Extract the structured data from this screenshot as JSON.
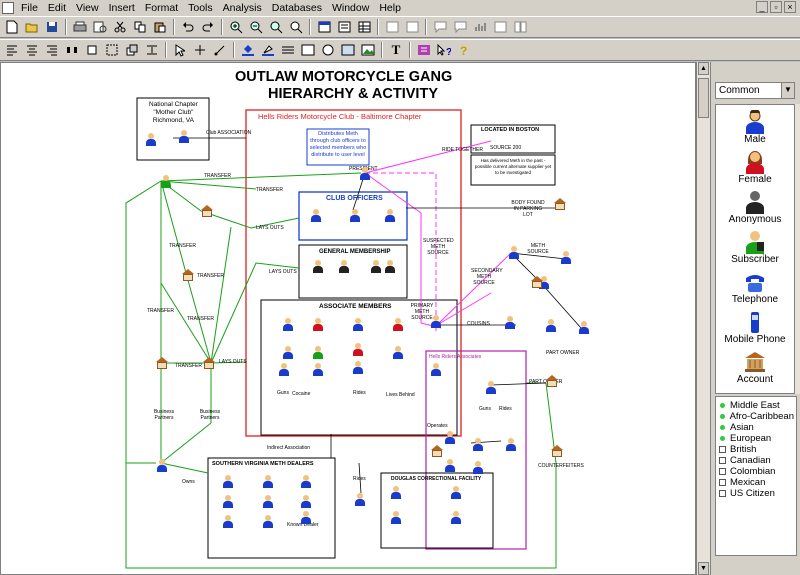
{
  "menu": [
    "File",
    "Edit",
    "View",
    "Insert",
    "Format",
    "Tools",
    "Analysis",
    "Databases",
    "Window",
    "Help"
  ],
  "window_controls": [
    "_",
    "▫",
    "×"
  ],
  "toolbar1": [
    "new-icon",
    "open-icon",
    "save-icon",
    "print-icon",
    "print-preview-icon",
    "cut-icon",
    "copy-icon",
    "paste-icon",
    "undo-icon",
    "redo-icon",
    "zoom-in-icon",
    "zoom-out-icon",
    "zoom-fit-icon",
    "zoom-select-icon",
    "grid-icon",
    "layout-icon",
    "table-icon",
    "list-icon"
  ],
  "toolbar2": [
    "select-icon",
    "cross-icon",
    "link-icon",
    "fill-icon",
    "line-color-icon",
    "line-style-icon",
    "rect-icon",
    "circle-icon",
    "frame-icon",
    "image-icon",
    "text-icon",
    "attributes-icon",
    "help-icon"
  ],
  "toolbar2_text_btn": "T",
  "diagram": {
    "title_line1": "OUTLAW MOTORCYCLE GANG",
    "title_line2": "HIERARCHY & ACTIVITY",
    "national_chapter": "National Chapter\n\"Mother Club\"\nRichmond, VA",
    "hells_riders": "Hells Riders Motorcycle Club - Baltimore Chapter",
    "distributes": "Distributes Meth through club officers to selected members who distribute to user level",
    "club_officers": "CLUB OFFICERS",
    "general_membership": "GENERAL MEMBERSHIP",
    "associate_members": "ASSOCIATE MEMBERS",
    "southern_dealers": "SOUTHERN VIRGINIA METH DEALERS",
    "douglas": "DOUGLAS CORRECTIONAL FACILITY",
    "located_boston": "LOCATED IN BOSTON",
    "source_200": "SOURCE 200",
    "has_delivered": "Has delivered Meth in the past - possible current alternate supplier yet to be investigated",
    "ride_together": "RIDE TOGETHER",
    "president": "PRESIDENT",
    "suspected_source": "SUSPECTED METH SOURCE",
    "primary_source": "PRIMARY METH SOURCE",
    "secondary_source": "SECONDARY METH SOURCE",
    "meth_source": "METH SOURCE",
    "cousins": "COUSINS",
    "business_partners_1": "Business Partners",
    "business_partners_2": "Business Partners",
    "indirect_association": "Indirect Association",
    "transfer": "TRANSFER",
    "lays_outs": "LAYS OUTS",
    "club_association": "Club ASSOCIATION",
    "body_found": "BODY FOUND IN PARKING LOT",
    "counterfeiters": "COUNTERFEITERS",
    "part_owner": "PART OWNER",
    "known_dealer": "Known Dealer",
    "hells_riders_associates": "Hells Riders Associates",
    "cocaine": "Cocaine",
    "guns": "Guns",
    "rides": "Rides",
    "operates": "Operates",
    "lives_behind": "Lives Behind",
    "owns": "Owns"
  },
  "palette": {
    "category": "Common",
    "items": [
      {
        "label": "Male",
        "icon": "male-person-icon"
      },
      {
        "label": "Female",
        "icon": "female-person-icon"
      },
      {
        "label": "Anonymous",
        "icon": "anonymous-person-icon"
      },
      {
        "label": "Subscriber",
        "icon": "subscriber-icon"
      },
      {
        "label": "Telephone",
        "icon": "telephone-icon"
      },
      {
        "label": "Mobile Phone",
        "icon": "mobile-phone-icon"
      },
      {
        "label": "Account",
        "icon": "account-icon"
      }
    ],
    "ethnicity": [
      {
        "label": "Middle East",
        "checked": true
      },
      {
        "label": "Afro-Caribbean",
        "checked": true
      },
      {
        "label": "Asian",
        "checked": true
      },
      {
        "label": "European",
        "checked": true
      },
      {
        "label": "British",
        "checked": false
      },
      {
        "label": "Canadian",
        "checked": false
      },
      {
        "label": "Colombian",
        "checked": false
      },
      {
        "label": "Mexican",
        "checked": false
      },
      {
        "label": "US Citizen",
        "checked": false
      }
    ]
  },
  "colors": {
    "red_frame": "#e02020",
    "blue_frame": "#1a3ccc",
    "magenta": "#ff33ff",
    "green": "#18a018",
    "black": "#000000"
  }
}
